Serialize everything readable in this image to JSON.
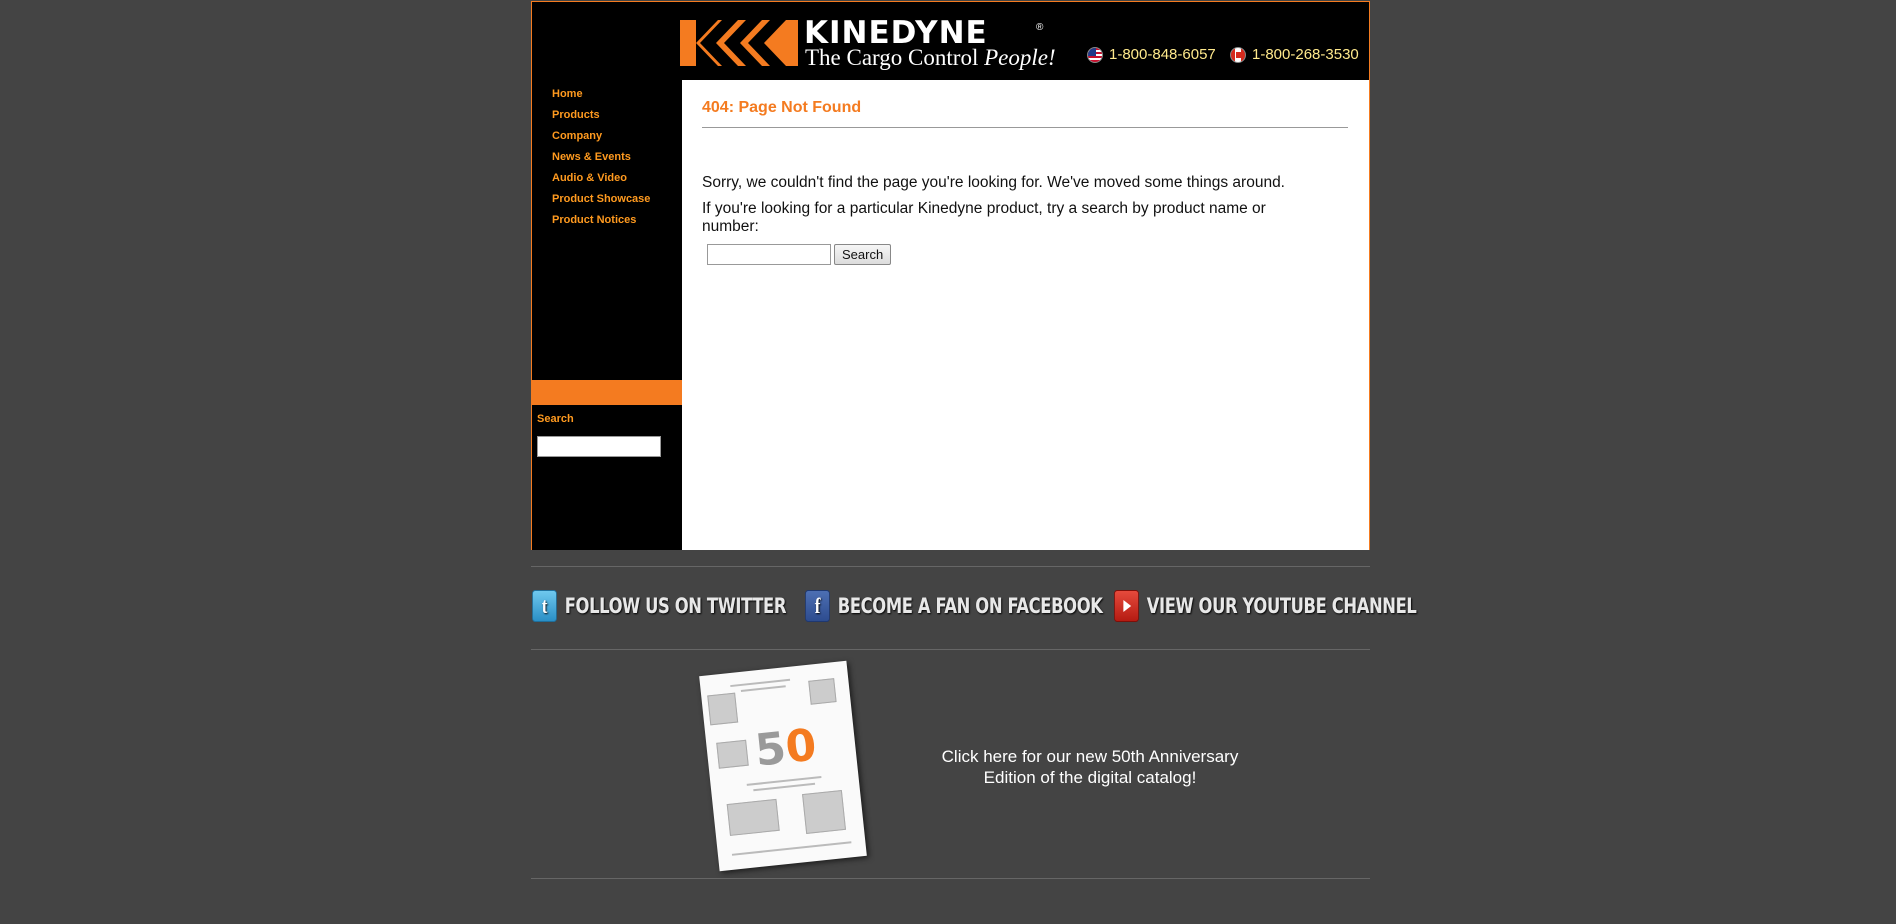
{
  "header": {
    "logo_word": "KINEDYNE",
    "logo_reg": "®",
    "tagline_plain": "The Cargo Control ",
    "tagline_italic": "People!",
    "phone_us": "1-800-848-6057",
    "phone_ca": "1-800-268-3530"
  },
  "nav": {
    "items": [
      {
        "label": "Home"
      },
      {
        "label": "Products"
      },
      {
        "label": "Company"
      },
      {
        "label": "News & Events"
      },
      {
        "label": "Audio & Video"
      },
      {
        "label": "Product Showcase"
      },
      {
        "label": "Product Notices"
      }
    ]
  },
  "sidebar": {
    "search_label": "Search"
  },
  "content": {
    "title": "404: Page Not Found",
    "message1": "Sorry, we couldn't find the page you're looking for. We've moved some things around.",
    "message2": "If you're looking for a particular Kinedyne product, try a search by product name or number:",
    "search_button": "Search"
  },
  "social": {
    "twitter": "FOLLOW US ON TWITTER",
    "facebook": "BECOME A FAN ON FACEBOOK",
    "youtube": "VIEW OUR YOUTUBE CHANNEL"
  },
  "catalog": {
    "link_text": "Click here for our new 50th Anniversary Edition of the digital catalog!",
    "cover_5": "5",
    "cover_0": "0"
  },
  "colors": {
    "accent": "#f47b20",
    "nav_text": "#ff9a1f",
    "phone_text": "#ffe98c",
    "page_bg": "#444444"
  }
}
